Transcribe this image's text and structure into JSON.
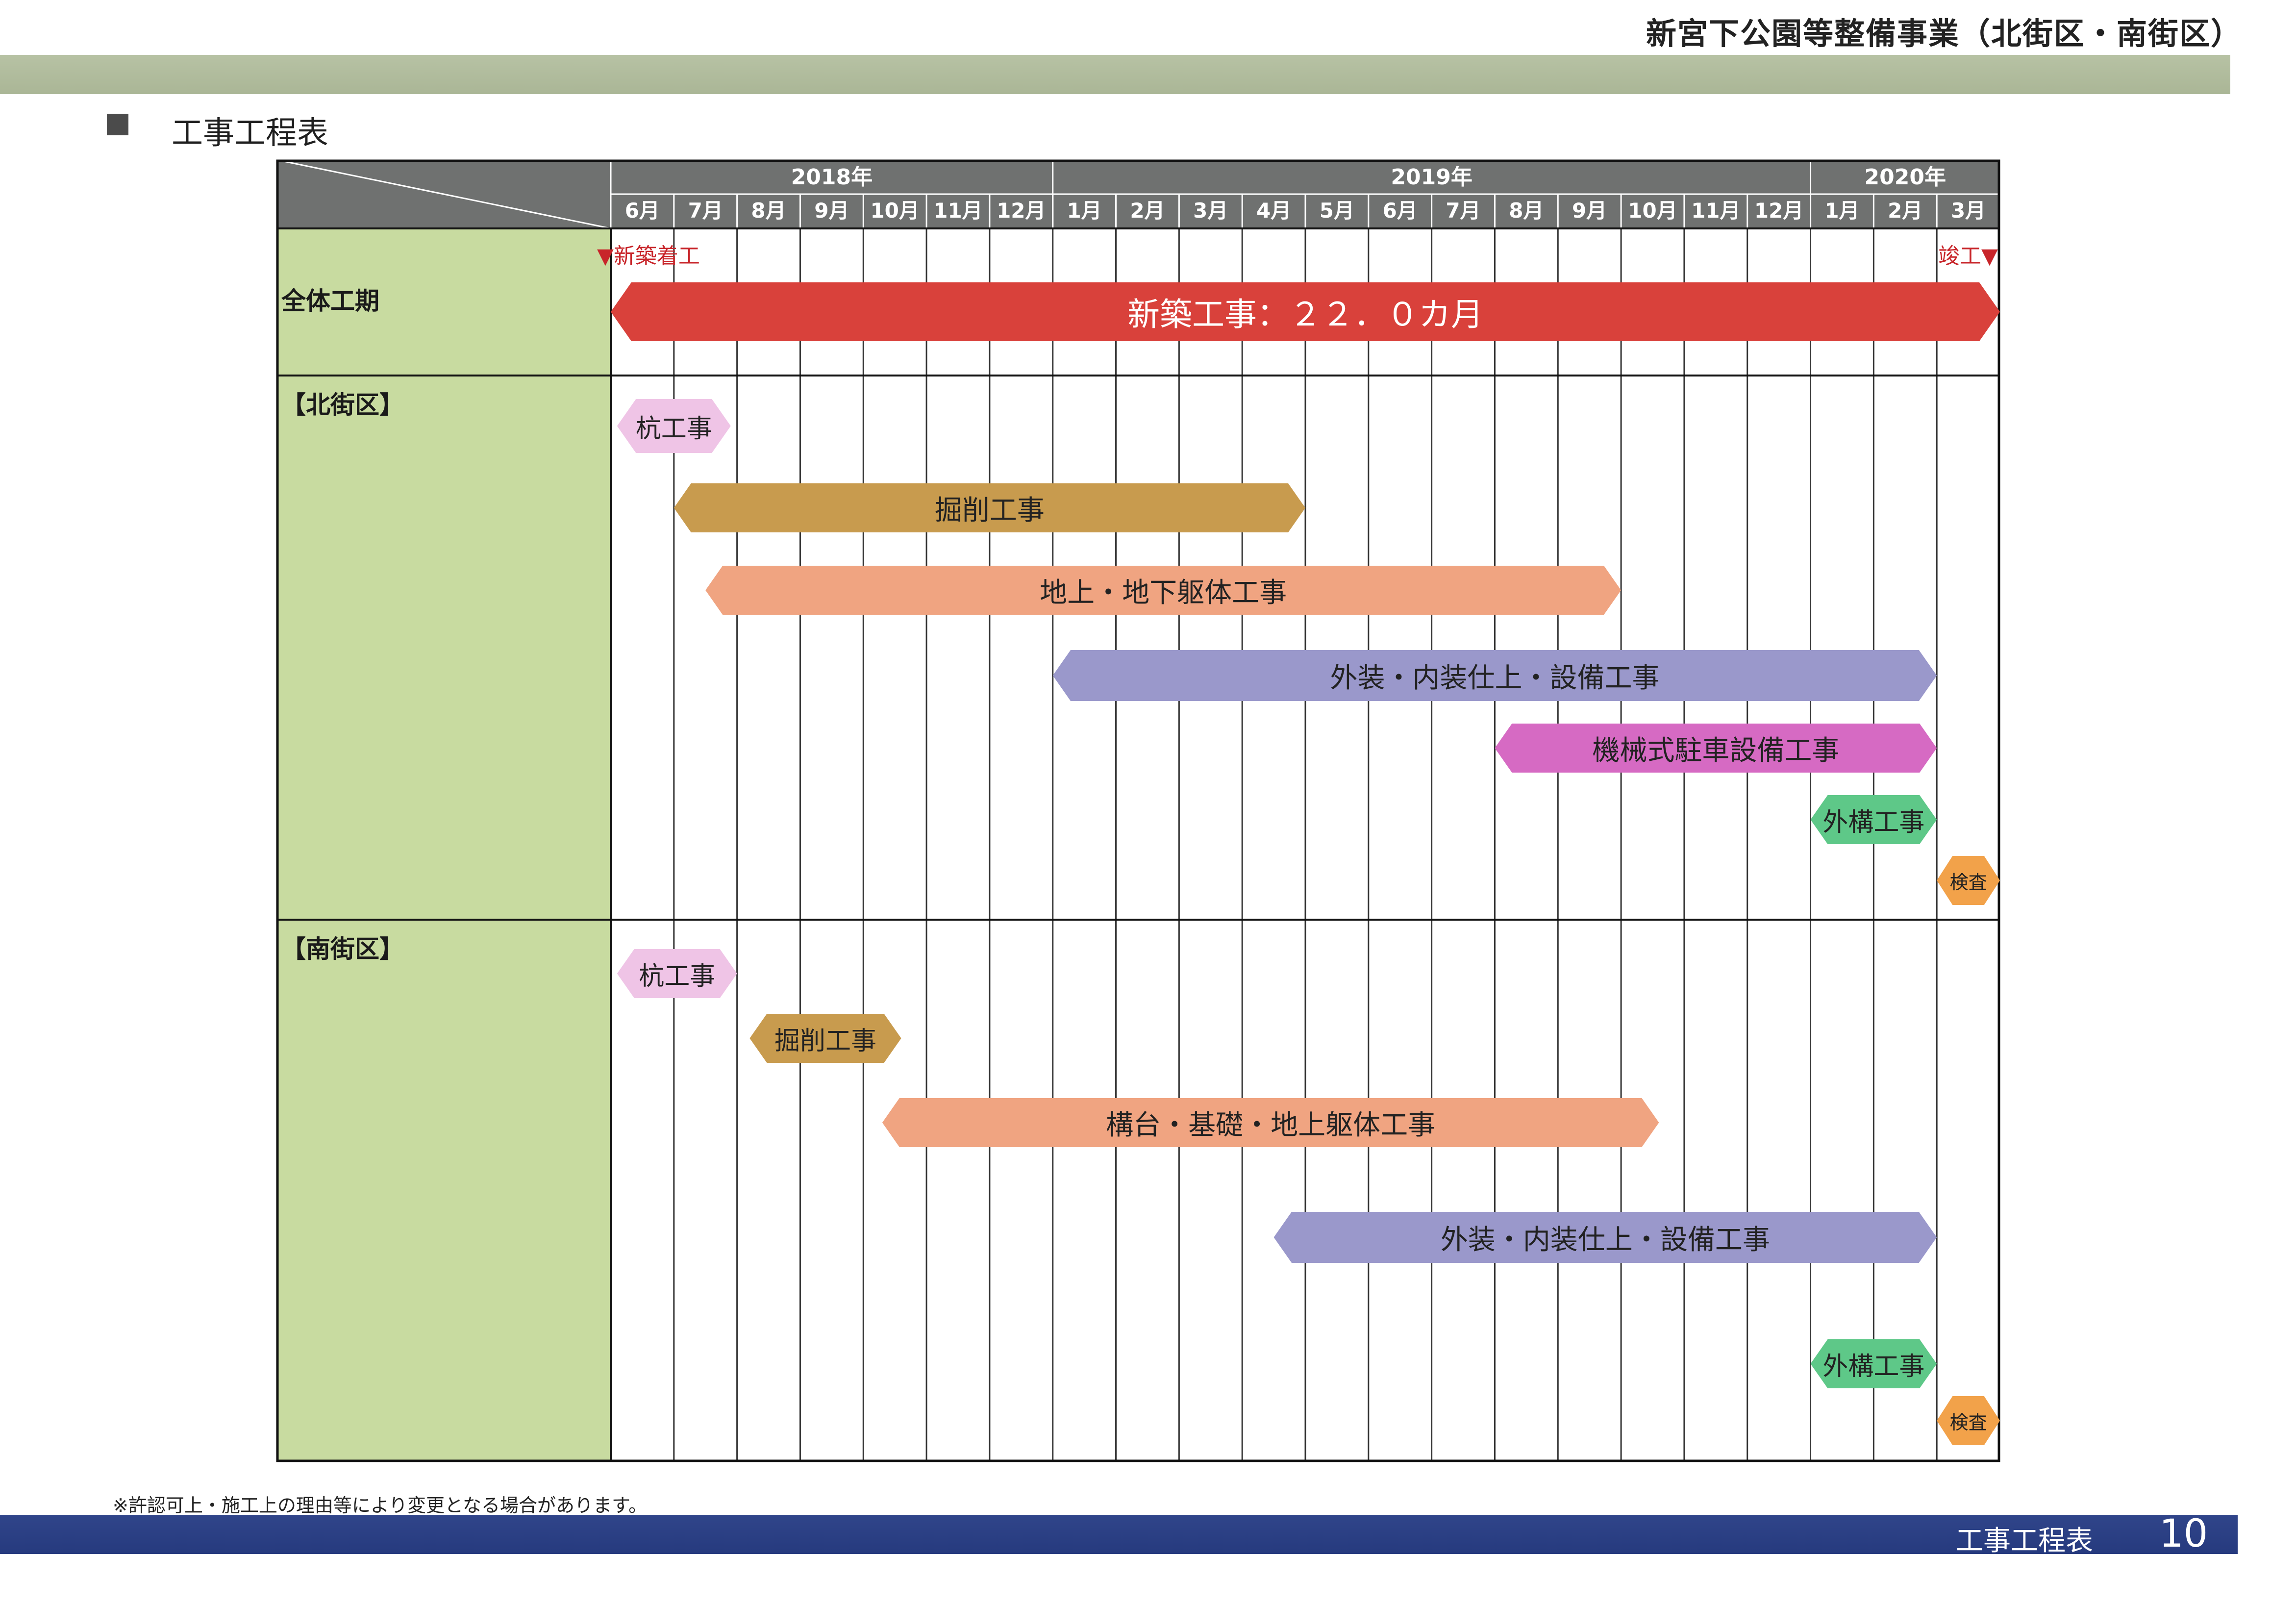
{
  "document": {
    "title": "新宮下公園等整備事業（北街区・南街区）",
    "section_title": "工事工程表",
    "footnote": "※許認可上・施工上の理由等により変更となる場合があります。",
    "footer_label": "工事工程表",
    "page_number": "10"
  },
  "gantt": {
    "years": [
      {
        "label": "2018年",
        "start": 0,
        "span": 7
      },
      {
        "label": "2019年",
        "start": 7,
        "span": 12
      },
      {
        "label": "2020年",
        "start": 19,
        "span": 3
      }
    ],
    "months": [
      "6月",
      "7月",
      "8月",
      "9月",
      "10月",
      "11月",
      "12月",
      "1月",
      "2月",
      "3月",
      "4月",
      "5月",
      "6月",
      "7月",
      "8月",
      "9月",
      "10月",
      "11月",
      "12月",
      "1月",
      "2月",
      "3月"
    ],
    "sections": {
      "overall": "全体工期",
      "north": "【北街区】",
      "south": "【南街区】"
    },
    "markers": {
      "start": "▼新築着工",
      "end": "竣工▼"
    },
    "colors": {
      "header": "#6f7170",
      "label_column": "#c8dba0",
      "grid": "#333333",
      "border": "#111111"
    },
    "bars": [
      {
        "id": "overall-new-construction",
        "label": "新築工事：２２．０カ月",
        "start": 0,
        "end": 22,
        "color": "#d9413b",
        "text_color": "#ffffff"
      },
      {
        "id": "north-pile",
        "label": "杭工事",
        "start": 0.1,
        "end": 1.9,
        "color": "#efc4e6"
      },
      {
        "id": "north-excavation",
        "label": "掘削工事",
        "start": 1.0,
        "end": 11.0,
        "color": "#c89b4e"
      },
      {
        "id": "north-frame",
        "label": "地上・地下躯体工事",
        "start": 1.5,
        "end": 16.0,
        "color": "#f0a481"
      },
      {
        "id": "north-finish",
        "label": "外装・内装仕上・設備工事",
        "start": 7.0,
        "end": 21.0,
        "color": "#9a98cb"
      },
      {
        "id": "north-parking",
        "label": "機械式駐車設備工事",
        "start": 14.0,
        "end": 21.0,
        "color": "#d66ac3"
      },
      {
        "id": "north-exterior",
        "label": "外構工事",
        "start": 19.0,
        "end": 21.0,
        "color": "#5ec888"
      },
      {
        "id": "north-inspection",
        "label": "検査",
        "start": 21.0,
        "end": 22.0,
        "color": "#f2a24a"
      },
      {
        "id": "south-pile",
        "label": "杭工事",
        "start": 0.1,
        "end": 2.0,
        "color": "#efc4e6"
      },
      {
        "id": "south-excavation",
        "label": "掘削工事",
        "start": 2.2,
        "end": 4.6,
        "color": "#c89b4e"
      },
      {
        "id": "south-frame",
        "label": "構台・基礎・地上躯体工事",
        "start": 4.3,
        "end": 16.6,
        "color": "#f0a481"
      },
      {
        "id": "south-finish",
        "label": "外装・内装仕上・設備工事",
        "start": 10.5,
        "end": 21.0,
        "color": "#9a98cb"
      },
      {
        "id": "south-exterior",
        "label": "外構工事",
        "start": 19.0,
        "end": 21.0,
        "color": "#5ec888"
      },
      {
        "id": "south-inspection",
        "label": "検査",
        "start": 21.0,
        "end": 22.0,
        "color": "#f2a24a"
      }
    ]
  }
}
